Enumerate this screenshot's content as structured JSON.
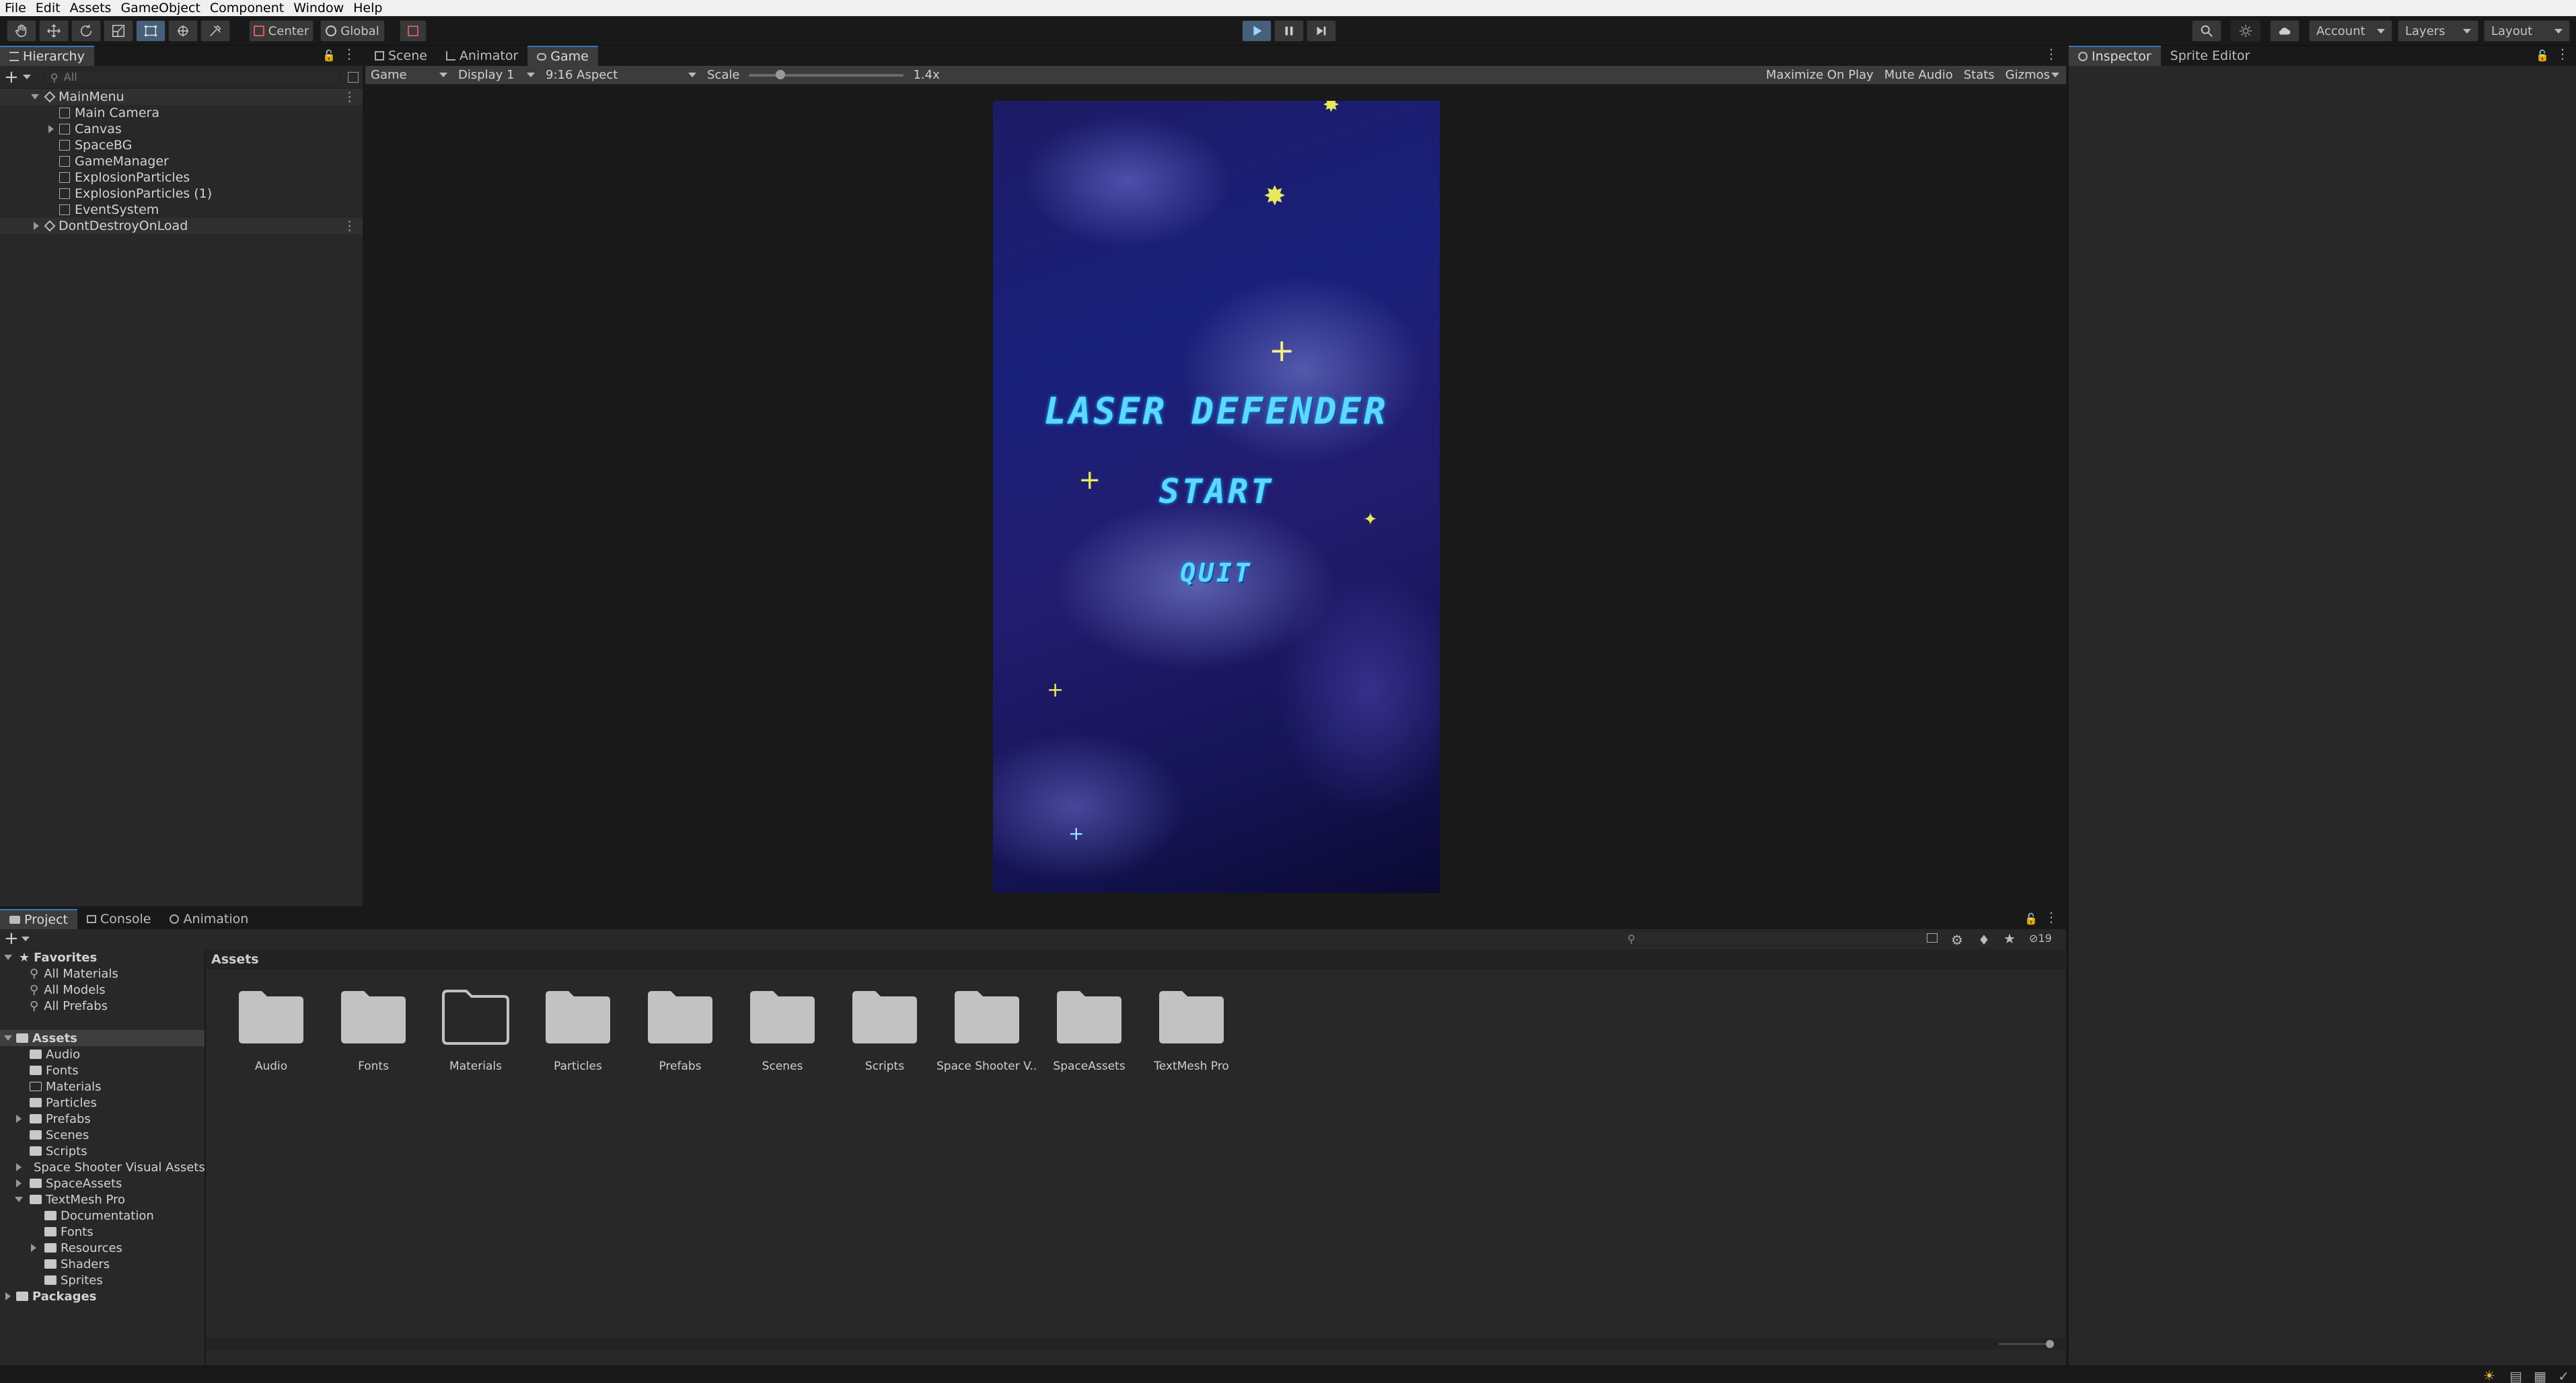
{
  "menu": [
    "File",
    "Edit",
    "Assets",
    "GameObject",
    "Component",
    "Window",
    "Help"
  ],
  "toolbar": {
    "pivot_label": "Center",
    "space_label": "Global",
    "account_label": "Account",
    "layers_label": "Layers",
    "layout_label": "Layout"
  },
  "hierarchy": {
    "tab_label": "Hierarchy",
    "search_placeholder": "All",
    "scenes": [
      {
        "name": "MainMenu",
        "children": [
          "Main Camera",
          "Canvas",
          "SpaceBG",
          "GameManager",
          "ExplosionParticles",
          "ExplosionParticles (1)",
          "EventSystem"
        ]
      },
      {
        "name": "DontDestroyOnLoad",
        "children": []
      }
    ]
  },
  "center": {
    "tabs": [
      "Scene",
      "Animator",
      "Game"
    ],
    "active_tab": "Game",
    "game_toolbar": {
      "mode": "Game",
      "display": "Display 1",
      "aspect": "9:16 Aspect",
      "scale_label": "Scale",
      "scale_value": "1.4x",
      "maximize": "Maximize On Play",
      "mute": "Mute Audio",
      "stats": "Stats",
      "gizmos": "Gizmos"
    },
    "game": {
      "title": "Laser Defender",
      "start": "START",
      "quit": "QUIT"
    }
  },
  "inspector": {
    "tabs": [
      "Inspector",
      "Sprite Editor"
    ]
  },
  "project": {
    "tabs": [
      "Project",
      "Console",
      "Animation"
    ],
    "hidden_count": "19",
    "favorites_label": "Favorites",
    "favorites": [
      "All Materials",
      "All Models",
      "All Prefabs"
    ],
    "assets_label": "Assets",
    "asset_tree": [
      {
        "name": "Audio",
        "depth": 1
      },
      {
        "name": "Fonts",
        "depth": 1
      },
      {
        "name": "Materials",
        "depth": 1,
        "empty": true
      },
      {
        "name": "Particles",
        "depth": 1
      },
      {
        "name": "Prefabs",
        "depth": 1,
        "collapsed": true
      },
      {
        "name": "Scenes",
        "depth": 1
      },
      {
        "name": "Scripts",
        "depth": 1
      },
      {
        "name": "Space Shooter Visual Assets",
        "depth": 1,
        "collapsed": true
      },
      {
        "name": "SpaceAssets",
        "depth": 1,
        "collapsed": true
      },
      {
        "name": "TextMesh Pro",
        "depth": 1,
        "expanded": true
      },
      {
        "name": "Documentation",
        "depth": 2
      },
      {
        "name": "Fonts",
        "depth": 2
      },
      {
        "name": "Resources",
        "depth": 2,
        "collapsed": true
      },
      {
        "name": "Shaders",
        "depth": 2
      },
      {
        "name": "Sprites",
        "depth": 2
      }
    ],
    "packages_label": "Packages",
    "breadcrumb": "Assets",
    "grid_items": [
      {
        "label": "Audio"
      },
      {
        "label": "Fonts"
      },
      {
        "label": "Materials",
        "empty": true
      },
      {
        "label": "Particles"
      },
      {
        "label": "Prefabs"
      },
      {
        "label": "Scenes"
      },
      {
        "label": "Scripts"
      },
      {
        "label": "Space Shooter V..."
      },
      {
        "label": "SpaceAssets"
      },
      {
        "label": "TextMesh Pro"
      }
    ]
  },
  "colors": {
    "accent": "#3a79bb",
    "play_active": "#46607c",
    "game_text": "#5fd8ff",
    "star": "#e6e95a"
  }
}
